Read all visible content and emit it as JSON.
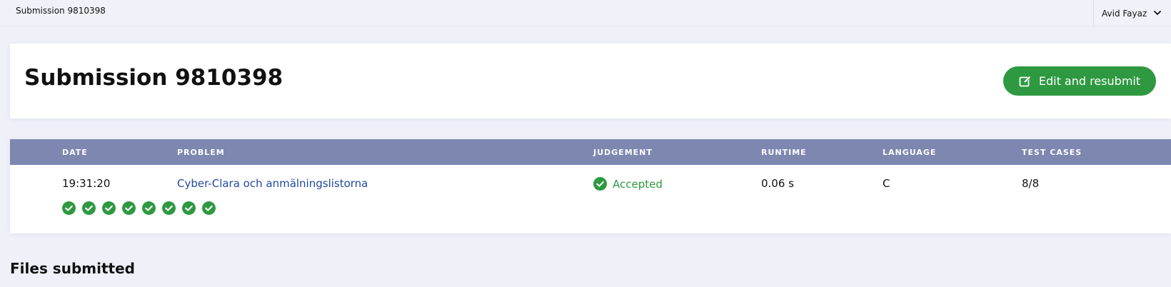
{
  "topbar": {
    "title": "Submission 9810398",
    "user_name": "Avid Fayaz"
  },
  "header": {
    "title": "Submission 9810398",
    "resubmit_label": "Edit and resubmit"
  },
  "table": {
    "columns": [
      "DATE",
      "PROBLEM",
      "JUDGEMENT",
      "RUNTIME",
      "LANGUAGE",
      "TEST CASES"
    ],
    "row": {
      "date": "19:31:20",
      "problem": "Cyber-Clara och anmälningslistorna",
      "judgement": "Accepted",
      "runtime": "0.06 s",
      "language": "C",
      "test_cases": "8/8"
    },
    "test_case_results": [
      "accepted",
      "accepted",
      "accepted",
      "accepted",
      "accepted",
      "accepted",
      "accepted",
      "accepted"
    ]
  },
  "files": {
    "heading": "Files submitted"
  },
  "colors": {
    "accent_green": "#2e9940",
    "table_header": "#7e87b0",
    "link": "#1f4aa0"
  }
}
